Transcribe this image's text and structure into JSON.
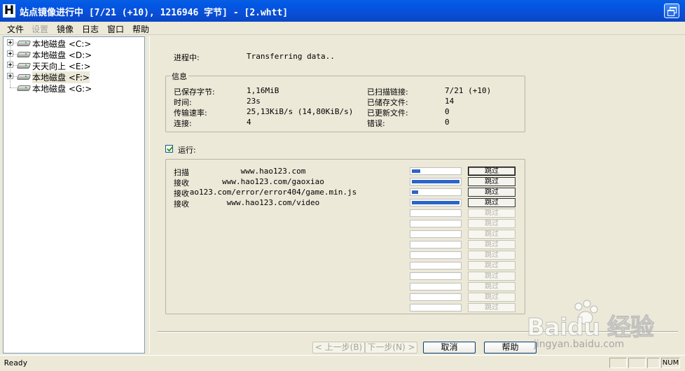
{
  "window": {
    "title": "站点镜像进行中 [7/21 (+10), 1216946 字节] - [2.whtt]",
    "app_icon_letter": "H"
  },
  "menu": [
    "文件",
    "设置",
    "镜像",
    "日志",
    "窗口",
    "帮助"
  ],
  "menu_disabled": [
    "设置"
  ],
  "tree": {
    "items": [
      {
        "label": "本地磁盘 <C:>",
        "expandable": true
      },
      {
        "label": "本地磁盘 <D:>",
        "expandable": true
      },
      {
        "label": "天天向上 <E:>",
        "expandable": true
      },
      {
        "label": "本地磁盘 <F:>",
        "expandable": true,
        "selected": true
      },
      {
        "label": "本地磁盘 <G:>",
        "expandable": false
      }
    ]
  },
  "progress": {
    "label": "进程中:",
    "value": "Transferring data.."
  },
  "info": {
    "title": "信息",
    "left": [
      {
        "label": "已保存字节:",
        "value": "1,16MiB"
      },
      {
        "label": "时间:",
        "value": "23s"
      },
      {
        "label": "传输速率:",
        "value": "25,13KiB/s (14,80KiB/s)"
      },
      {
        "label": "连接:",
        "value": "4"
      }
    ],
    "right": [
      {
        "label": "已扫描链接:",
        "value": "7/21 (+10)"
      },
      {
        "label": "已储存文件:",
        "value": "14"
      },
      {
        "label": "已更新文件:",
        "value": "0"
      },
      {
        "label": "错误:",
        "value": "0"
      }
    ]
  },
  "running": {
    "label": "运行:",
    "checked": true
  },
  "transfers": [
    {
      "action": "扫描",
      "url": "www.hao123.com",
      "progress": 0.17
    },
    {
      "action": "接收",
      "url": "www.hao123.com/gaoxiao",
      "progress": 1.0
    },
    {
      "action": "接收",
      "url": "ao123.com/error/error404/game.min.js",
      "progress": 0.13
    },
    {
      "action": "接收",
      "url": "www.hao123.com/video",
      "progress": 1.0
    }
  ],
  "skip_label": "跳过",
  "empty_slots": 10,
  "buttons": {
    "back": "< 上一步(B)",
    "next": "下一步(N) >",
    "cancel": "取消",
    "help": "帮助"
  },
  "status": {
    "text": "Ready",
    "num": "NUM"
  },
  "watermark": {
    "text": "Baidu 经验",
    "sub": "jingyan.baidu.com"
  }
}
